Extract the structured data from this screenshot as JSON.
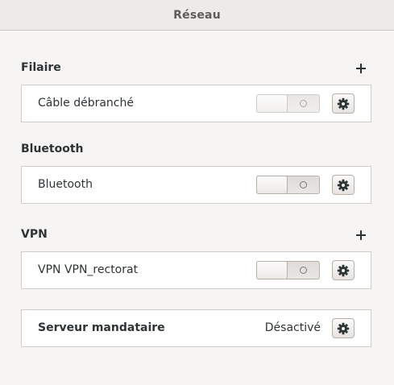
{
  "window": {
    "title": "Réseau"
  },
  "sections": {
    "wired": {
      "title": "Filaire",
      "row": {
        "label": "Câble débranché",
        "switch_on": false,
        "enabled": false
      }
    },
    "bluetooth": {
      "title": "Bluetooth",
      "row": {
        "label": "Bluetooth",
        "switch_on": false,
        "enabled": true
      }
    },
    "vpn": {
      "title": "VPN",
      "row": {
        "label": "VPN VPN_rectorat",
        "switch_on": false,
        "enabled": true
      }
    },
    "proxy": {
      "row": {
        "label": "Serveur mandataire",
        "status": "Désactivé"
      }
    }
  },
  "icons": {
    "add": "plus-icon",
    "settings": "gear-icon",
    "switch_off": "circle-icon"
  },
  "colors": {
    "background": "#f6f5f4",
    "header": "#edebe9",
    "row": "#ffffff",
    "text": "#2e3436"
  }
}
